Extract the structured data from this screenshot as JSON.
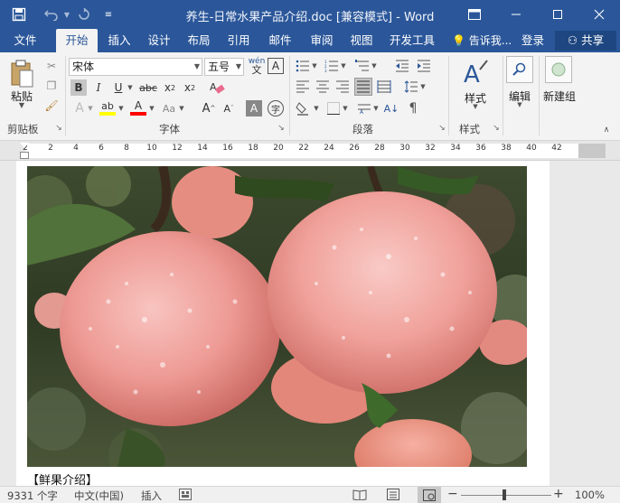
{
  "titlebar": {
    "title": "养生-日常水果产品介绍.doc [兼容模式] - Word",
    "save_icon": "save-icon",
    "undo_icon": "undo-icon",
    "redo_icon": "redo-icon",
    "customize_icon": "customize-icon"
  },
  "tabs": [
    "文件",
    "开始",
    "插入",
    "设计",
    "布局",
    "引用",
    "邮件",
    "审阅",
    "视图",
    "开发工具"
  ],
  "tell_me": "告诉我...",
  "sign_in": "登录",
  "share": "共享",
  "ribbon": {
    "clipboard": {
      "paste": "粘贴",
      "label": "剪贴板"
    },
    "font": {
      "name": "宋体",
      "size": "五号",
      "wen": "wén",
      "label": "字体"
    },
    "paragraph": {
      "label": "段落"
    },
    "styles": {
      "styles_btn": "样式",
      "label": "样式"
    },
    "editing": {
      "edit_btn": "编辑"
    },
    "new_group": {
      "btn": "新建组"
    }
  },
  "ruler_ticks": [
    "2",
    "2",
    "4",
    "6",
    "8",
    "10",
    "12",
    "14",
    "16",
    "18",
    "20",
    "22",
    "24",
    "26",
    "28",
    "30",
    "32",
    "34",
    "36",
    "38",
    "40",
    "42"
  ],
  "document": {
    "caption": "【鲜果介绍】"
  },
  "statusbar": {
    "word_count": "9331 个字",
    "language": "中文(中国)",
    "mode": "插入",
    "zoom": "100%"
  },
  "colors": {
    "accent": "#2b579a",
    "highlight": "#ffff00",
    "font_color": "#ff0000"
  }
}
